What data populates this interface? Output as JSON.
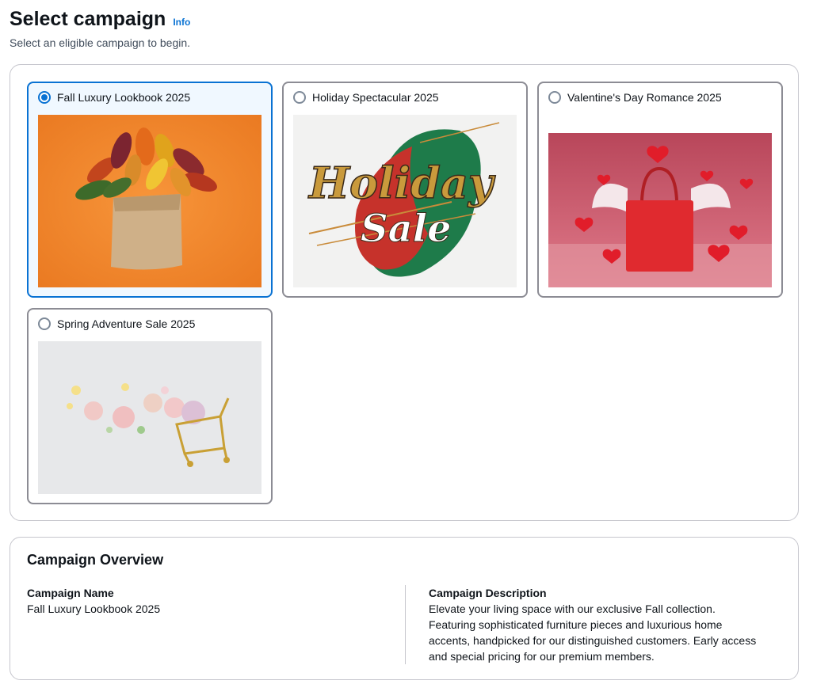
{
  "header": {
    "title": "Select campaign",
    "info_label": "Info",
    "subtitle": "Select an eligible campaign to begin."
  },
  "campaigns": [
    {
      "label": "Fall Luxury Lookbook 2025",
      "selected": true,
      "image": "fall-leaves-bag-image"
    },
    {
      "label": "Holiday Spectacular 2025",
      "selected": false,
      "image": "holiday-sale-image"
    },
    {
      "label": "Valentine's Day Romance 2025",
      "selected": false,
      "image": "valentine-bag-image"
    },
    {
      "label": "Spring Adventure Sale 2025",
      "selected": false,
      "image": "spring-flowers-cart-image"
    }
  ],
  "overview": {
    "title": "Campaign Overview",
    "name_label": "Campaign Name",
    "name_value": "Fall Luxury Lookbook 2025",
    "description_label": "Campaign Description",
    "description_value": "Elevate your living space with our exclusive Fall collection. Featuring sophisticated furniture pieces and luxurious home accents, handpicked for our distinguished customers. Early access and special pricing for our premium members."
  },
  "colors": {
    "accent": "#0972d3",
    "selected_bg": "#f0f8ff",
    "card_border": "#8c8c94"
  }
}
